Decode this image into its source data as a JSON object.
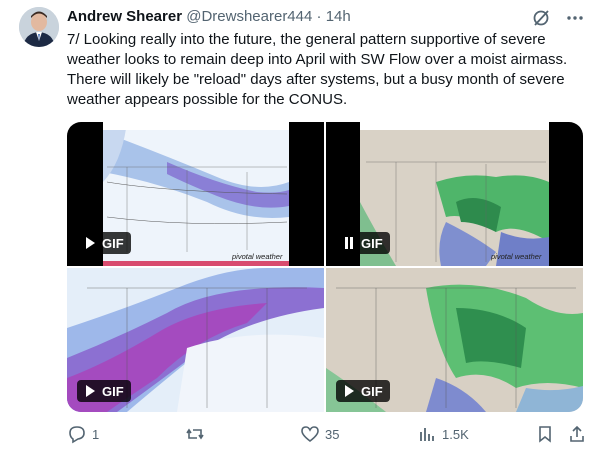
{
  "tweet": {
    "author_name": "Andrew Shearer",
    "handle": "@Drewshearer444",
    "separator": "·",
    "time": "14h",
    "text": "7/ Looking really into the future, the general pattern supportive of severe weather looks to remain deep into April with SW Flow over a moist airmass. There will likely be \"reload\" days after systems, but a busy month of severe weather appears possible for the CONUS."
  },
  "media": [
    {
      "badge": "GIF",
      "control": "play-icon",
      "watermark": "pivotal weather"
    },
    {
      "badge": "GIF",
      "control": "pause-icon",
      "watermark": "pivotal weather"
    },
    {
      "badge": "GIF",
      "control": "play-icon"
    },
    {
      "badge": "GIF",
      "control": "play-icon"
    }
  ],
  "actions": {
    "replies": "1",
    "reposts": "",
    "likes": "35",
    "views": "1.5K"
  },
  "colors": {
    "text": "#0f1419",
    "muted": "#536471",
    "brand_accent": "#1d9bf0"
  }
}
